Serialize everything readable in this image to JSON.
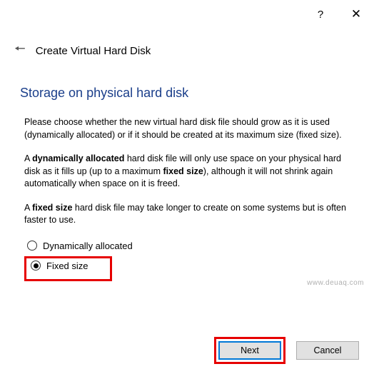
{
  "window": {
    "title": "Create Virtual Hard Disk"
  },
  "page": {
    "heading": "Storage on physical hard disk"
  },
  "paragraphs": {
    "intro": "Please choose whether the new virtual hard disk file should grow as it is used (dynamically allocated) or if it should be created at its maximum size (fixed size).",
    "dynamic_pre": "A ",
    "dynamic_bold": "dynamically allocated",
    "dynamic_mid": " hard disk file will only use space on your physical hard disk as it fills up (up to a maximum ",
    "dynamic_bold2": "fixed size",
    "dynamic_post": "), although it will not shrink again automatically when space on it is freed.",
    "fixed_pre": "A ",
    "fixed_bold": "fixed size",
    "fixed_post": " hard disk file may take longer to create on some systems but is often faster to use."
  },
  "options": {
    "dynamic": "Dynamically allocated",
    "fixed": "Fixed size"
  },
  "buttons": {
    "next": "Next",
    "cancel": "Cancel"
  },
  "watermark": "www.deuaq.com"
}
